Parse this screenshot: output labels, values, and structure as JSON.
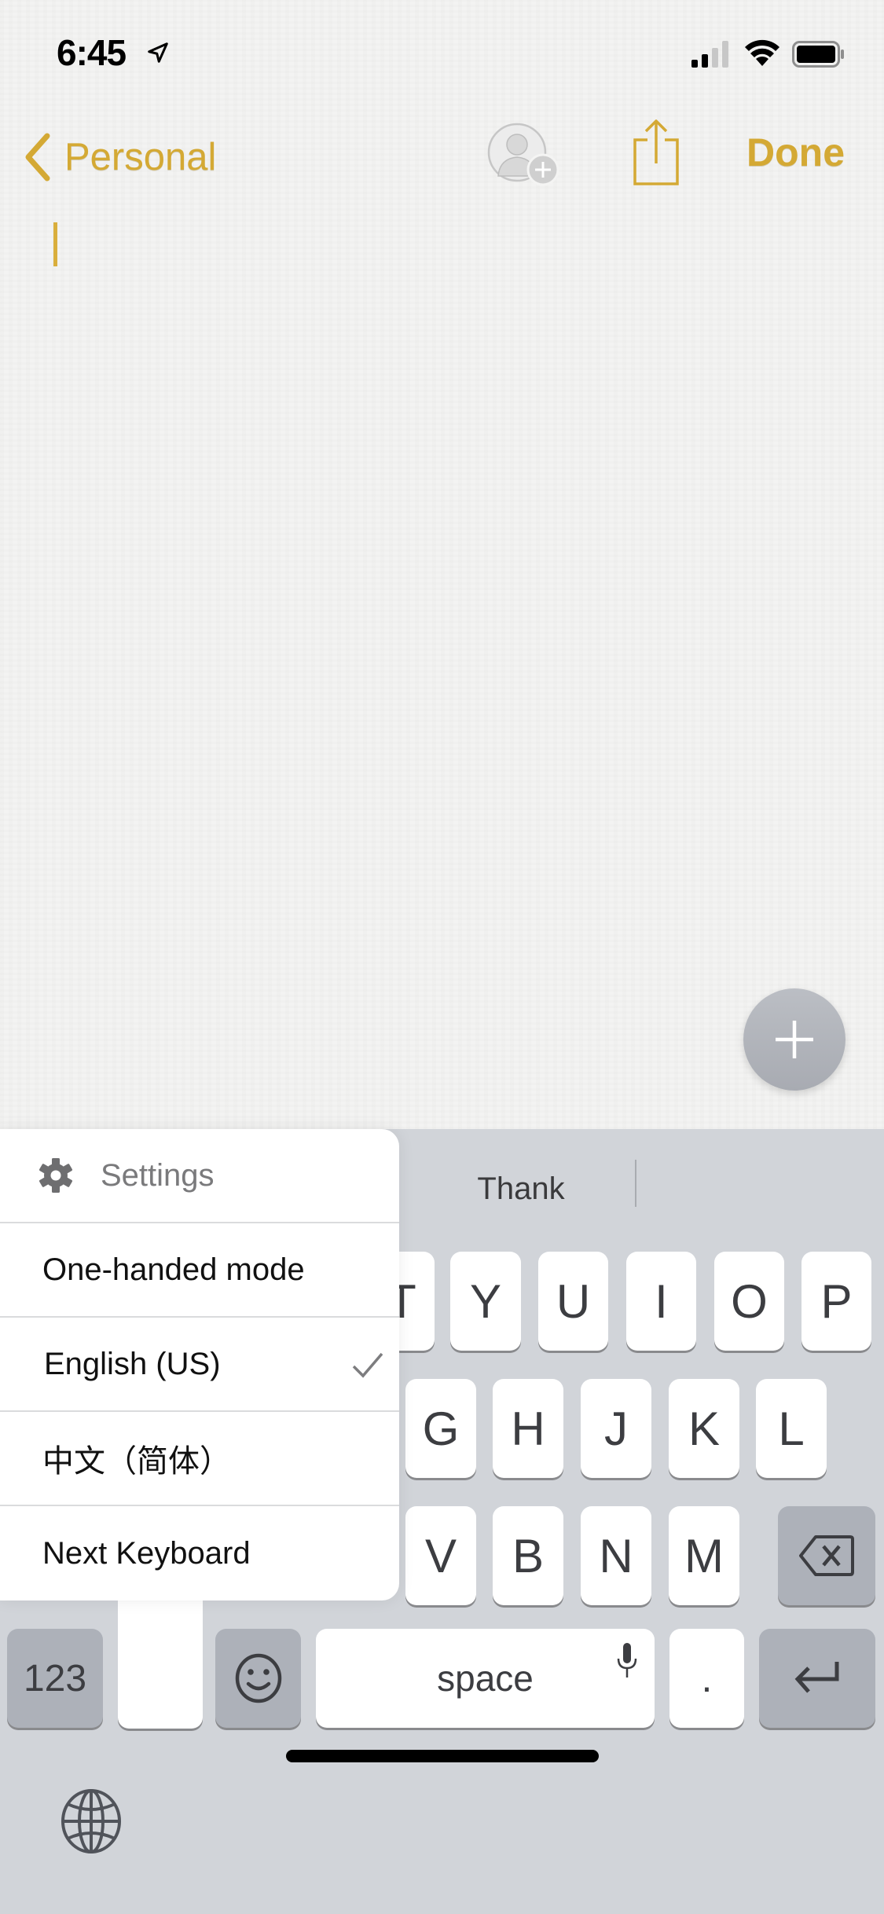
{
  "status_bar": {
    "time": "6:45",
    "location_icon": "location-arrow-icon",
    "signal_icon": "cellular-signal-icon",
    "wifi_icon": "wifi-icon",
    "battery_icon": "battery-icon"
  },
  "nav": {
    "back_label": "Personal",
    "back_icon": "chevron-left-icon",
    "collab_icon": "add-person-icon",
    "share_icon": "share-icon",
    "done_label": "Done",
    "accent_color": "#d4a934"
  },
  "note": {
    "body_text": "",
    "fab_icon": "plus-icon"
  },
  "keyboard": {
    "suggestion": "Thank",
    "row1": [
      "T",
      "Y",
      "U",
      "I",
      "O",
      "P"
    ],
    "row2": [
      "G",
      "H",
      "J",
      "K",
      "L"
    ],
    "row3": [
      "V",
      "B",
      "N",
      "M"
    ],
    "delete_icon": "backspace-icon",
    "numbers_label": "123",
    "emoji_icon": "smiley-icon",
    "space_label": "space",
    "mic_icon": "microphone-icon",
    "period_label": ".",
    "return_icon": "return-arrow-icon",
    "globe_icon": "globe-icon"
  },
  "keyboard_menu": {
    "settings_label": "Settings",
    "items": [
      {
        "label": "One-handed mode",
        "checked": false
      },
      {
        "label": "English (US)",
        "checked": true
      },
      {
        "label": "中文（简体）",
        "checked": false
      },
      {
        "label": "Next Keyboard",
        "checked": false
      }
    ]
  }
}
